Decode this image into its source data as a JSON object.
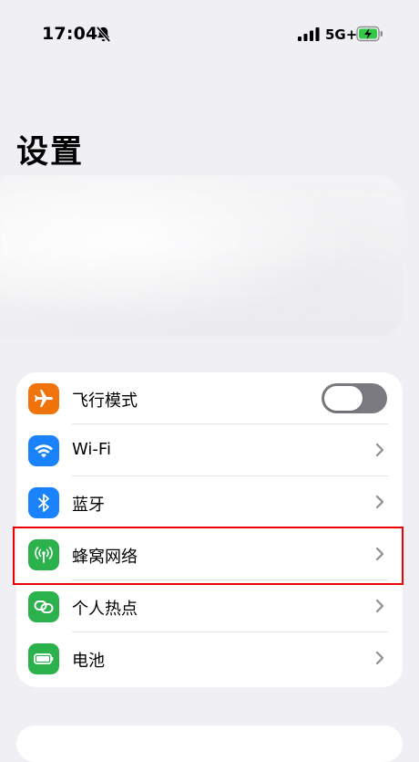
{
  "status_bar": {
    "time": "17:04",
    "network": "5G+",
    "icons": [
      "mute-bell-icon",
      "signal-icon",
      "battery-charging-icon"
    ]
  },
  "page": {
    "title": "设置"
  },
  "settings": {
    "items": [
      {
        "label": "飞行模式",
        "icon": "airplane-icon",
        "color": "#f0730c",
        "control": "toggle",
        "toggle_on": false
      },
      {
        "label": "Wi-Fi",
        "icon": "wifi-icon",
        "color": "#1a82fb",
        "control": "chevron"
      },
      {
        "label": "蓝牙",
        "icon": "bluetooth-icon",
        "color": "#1a82fb",
        "control": "chevron"
      },
      {
        "label": "蜂窝网络",
        "icon": "antenna-icon",
        "color": "#2bb24c",
        "control": "chevron",
        "highlighted": true
      },
      {
        "label": "个人热点",
        "icon": "hotspot-link-icon",
        "color": "#2bb24c",
        "control": "chevron"
      },
      {
        "label": "电池",
        "icon": "battery-icon",
        "color": "#2bb24c",
        "control": "chevron"
      }
    ]
  },
  "colors": {
    "background": "#efeff4",
    "highlight": "#ee0000",
    "toggle_off": "#7a7a80"
  }
}
